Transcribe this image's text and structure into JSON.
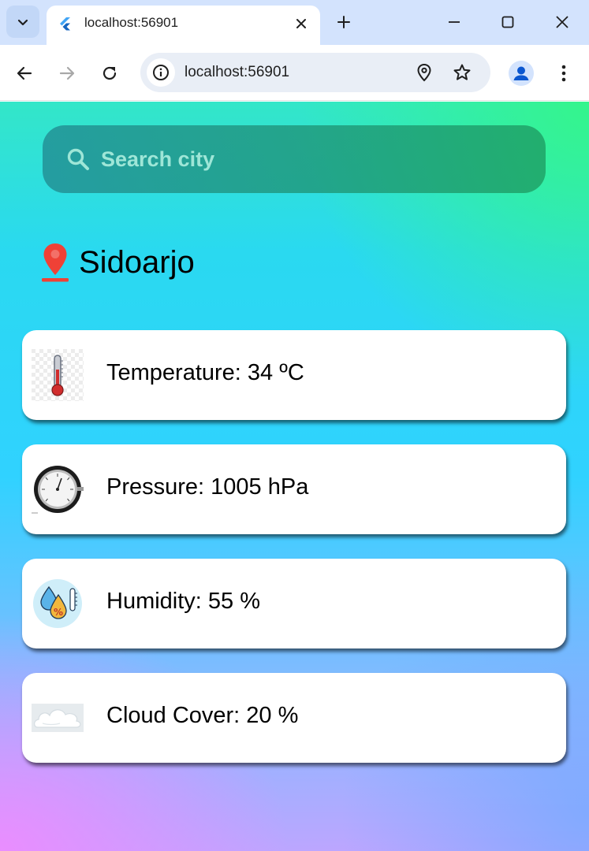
{
  "browser": {
    "tab_title": "localhost:56901",
    "url": "localhost:56901"
  },
  "search": {
    "placeholder": "Search city"
  },
  "location": {
    "city": "Sidoarjo"
  },
  "weather_cards": [
    {
      "icon": "thermometer-icon",
      "label": "Temperature: 34 ºC"
    },
    {
      "icon": "barometer-icon",
      "label": "Pressure: 1005 hPa"
    },
    {
      "icon": "humidity-icon",
      "label": "Humidity: 55 %"
    },
    {
      "icon": "cloud-icon",
      "label": "Cloud Cover: 20 %"
    }
  ],
  "colors": {
    "pin": "#ef4136",
    "search_bar": "#1e9a80",
    "tabstrip": "#d3e3fd"
  }
}
